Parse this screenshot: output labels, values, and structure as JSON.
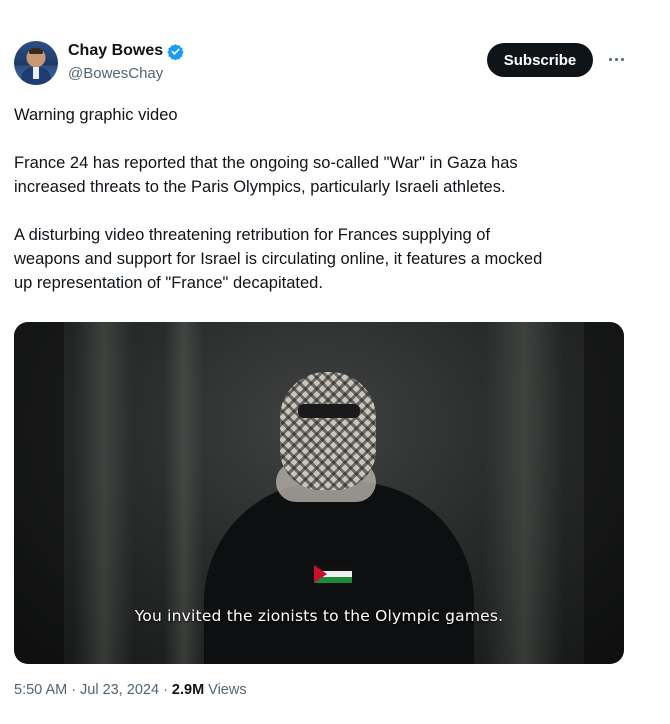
{
  "author": {
    "display_name": "Chay Bowes",
    "handle": "@BowesChay",
    "verified_badge": "verified-badge-icon",
    "badge_color": "#1d9bf0"
  },
  "actions": {
    "subscribe_label": "Subscribe",
    "more_icon": "more-options-icon"
  },
  "tweet": {
    "paragraphs": [
      "Warning graphic video",
      "France 24 has reported that the ongoing so-called \"War\" in Gaza has\nincreased threats to the Paris Olympics, particularly  Israeli athletes.",
      "A disturbing video threatening retribution for Frances supplying of\nweapons and support for Israel is circulating online, it features a mocked\nup representation of \"France\" decapitated."
    ]
  },
  "media": {
    "caption": "You invited the zionists to the Olympic games."
  },
  "meta": {
    "time": "5:50 AM",
    "separator1": "·",
    "date": "Jul 23, 2024",
    "separator2": "·",
    "views_count": "2.9M",
    "views_label": "Views"
  }
}
